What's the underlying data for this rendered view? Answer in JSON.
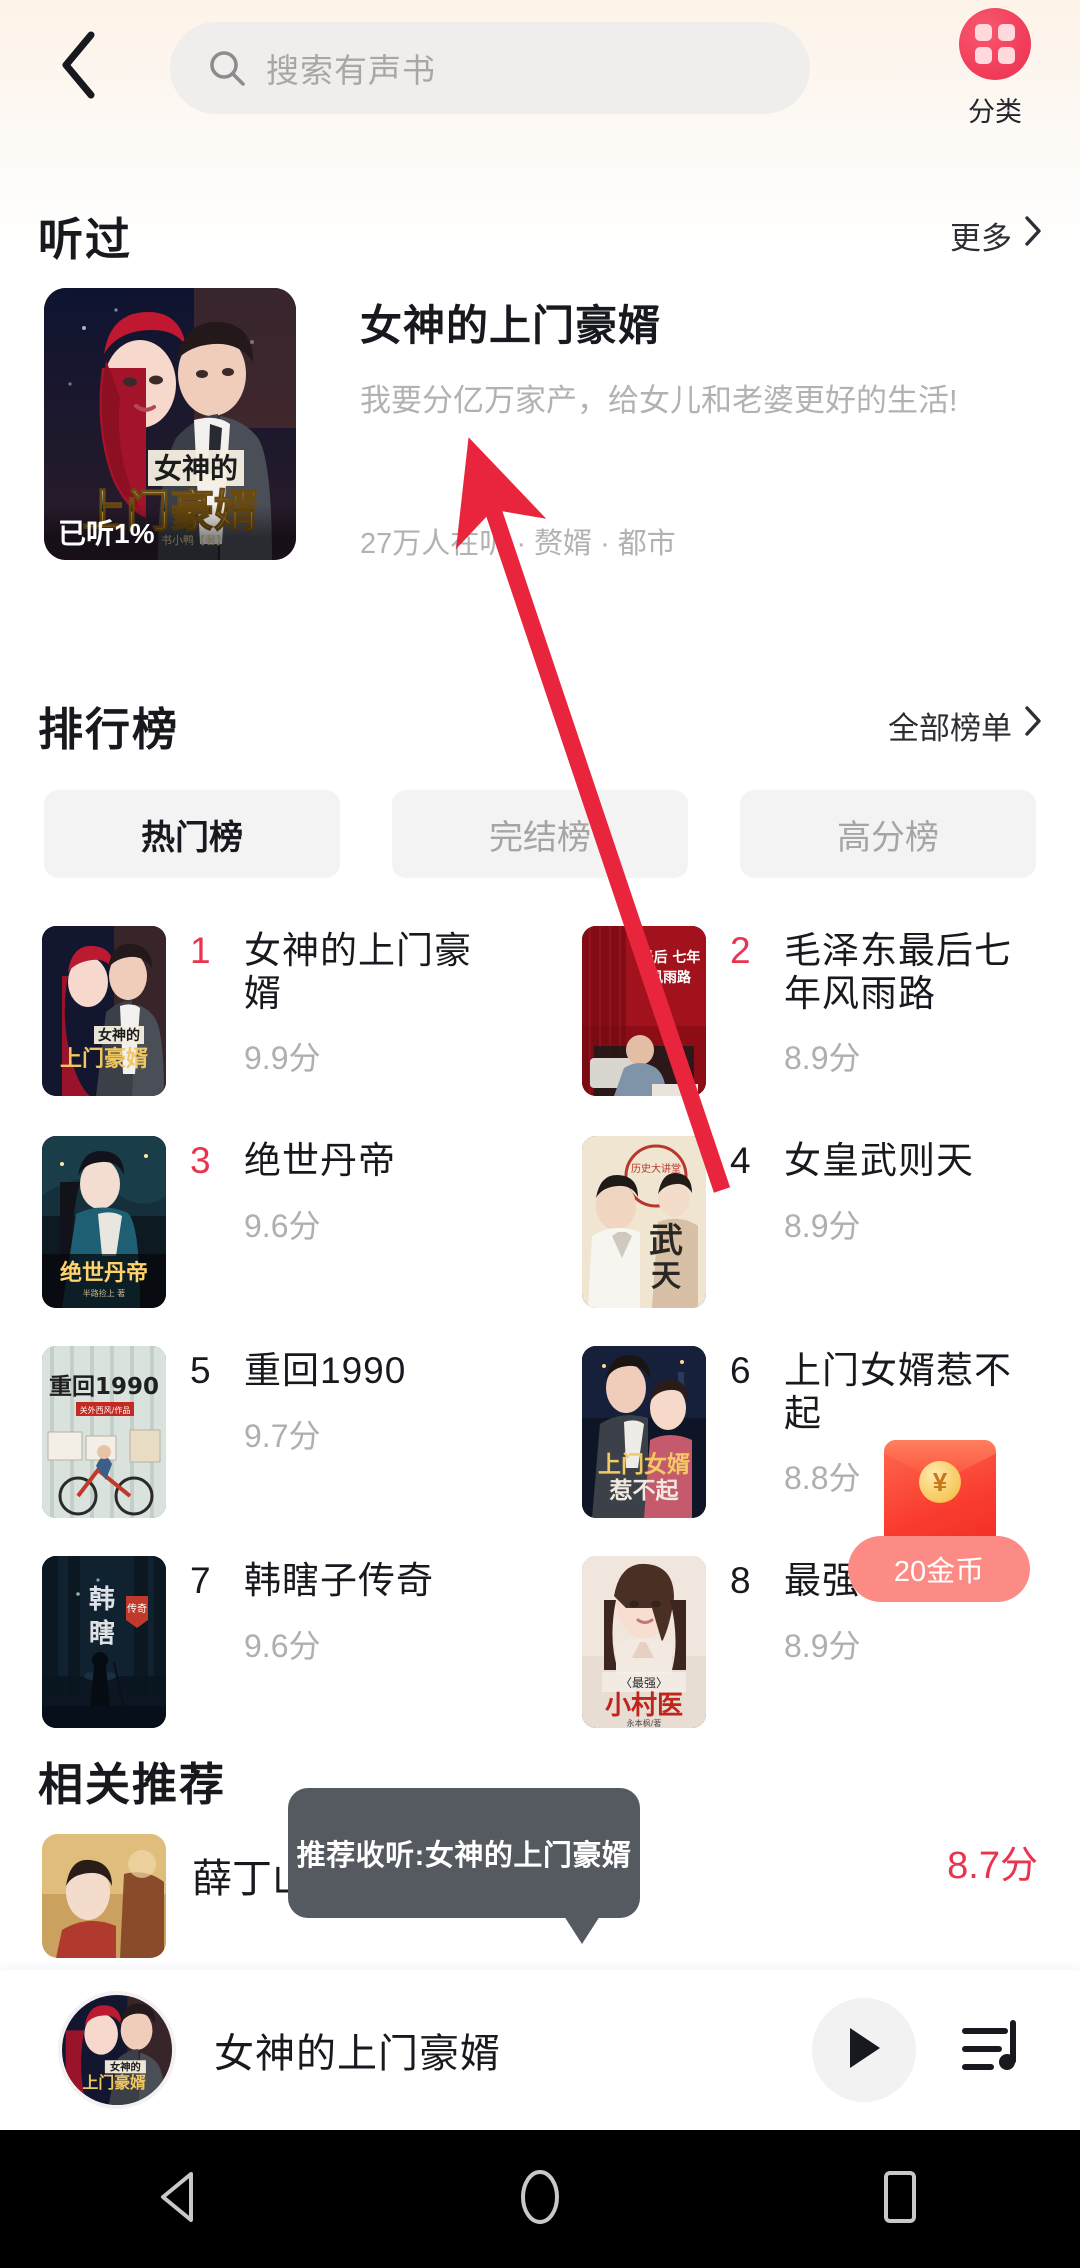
{
  "header": {
    "back_icon": "chevron-left-icon",
    "search": {
      "icon": "search-icon",
      "placeholder": "搜索有声书",
      "value": ""
    },
    "category": {
      "icon": "grid-category-icon",
      "label": "分类"
    }
  },
  "heard_section": {
    "title": "听过",
    "more_label": "更多",
    "item": {
      "title": "女神的上门豪婿",
      "description": "我要分亿万家产，给女儿和老婆更好的生活!",
      "meta": "27万人在听 · 赘婿 · 都市",
      "progress_badge": "已听1%",
      "cover_title_top": "女神的",
      "cover_title_main": "上门豪婿"
    }
  },
  "rank_section": {
    "title": "排行榜",
    "more_label": "全部榜单",
    "tabs": [
      {
        "label": "热门榜",
        "active": true
      },
      {
        "label": "完结榜",
        "active": false
      },
      {
        "label": "高分榜",
        "active": false
      }
    ],
    "items": [
      {
        "rank": "1",
        "title": "女神的上门豪婿",
        "score": "9.9分",
        "rank_hot": true
      },
      {
        "rank": "2",
        "title": "毛泽东最后七年风雨路",
        "score": "8.9分",
        "rank_hot": true
      },
      {
        "rank": "3",
        "title": "绝世丹帝",
        "score": "9.6分",
        "rank_hot": true
      },
      {
        "rank": "4",
        "title": "女皇武则天",
        "score": "8.9分",
        "rank_hot": false
      },
      {
        "rank": "5",
        "title": "重回1990",
        "score": "9.7分",
        "rank_hot": false
      },
      {
        "rank": "6",
        "title": "上门女婿惹不起",
        "score": "8.8分",
        "rank_hot": false
      },
      {
        "rank": "7",
        "title": "韩瞎子传奇",
        "score": "9.6分",
        "rank_hot": false
      },
      {
        "rank": "8",
        "title": "最强",
        "score": "8.9分",
        "rank_hot": false
      }
    ]
  },
  "recommend_section": {
    "title": "相关推荐",
    "items": [
      {
        "title": "薛丁山征西",
        "score": "8.7分"
      }
    ]
  },
  "tooltip": {
    "text": "推荐收听:女神的上门豪婿"
  },
  "red_packet": {
    "coin_symbol": "¥",
    "pill_label": "20金币"
  },
  "player": {
    "title": "女神的上门豪婿",
    "play_icon": "play-icon",
    "playlist_icon": "playlist-icon"
  },
  "navbar": {
    "back_icon": "android-back-icon",
    "home_icon": "android-home-icon",
    "recents_icon": "android-recents-icon"
  },
  "annotation": {
    "arrow_color": "#e8253c"
  },
  "colors": {
    "accent_red": "#e8344f",
    "text_primary": "#17191f",
    "text_muted": "#b3b1b1",
    "chip_bg": "#f4f3f3"
  }
}
